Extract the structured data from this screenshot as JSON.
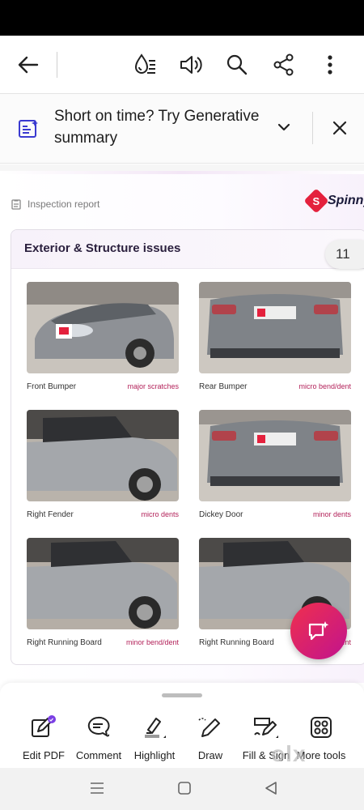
{
  "banner": {
    "text": "Short on time? Try Generative summary"
  },
  "report": {
    "label": "Inspection report",
    "brand": "Spinny",
    "brand_letter": "S",
    "section_title": "Exterior & Structure issues",
    "items": [
      {
        "part": "Front Bumper",
        "issue": "major scratches"
      },
      {
        "part": "Rear Bumper",
        "issue": "micro bend/dent"
      },
      {
        "part": "Right Fender",
        "issue": "micro dents"
      },
      {
        "part": "Dickey Door",
        "issue": "minor dents"
      },
      {
        "part": "Right Running Board",
        "issue": "minor bend/dent"
      },
      {
        "part": "Right Running Board",
        "issue": "ent"
      }
    ]
  },
  "page_indicator": "11",
  "tools": [
    {
      "label": "Edit PDF",
      "icon": "edit-pdf-icon"
    },
    {
      "label": "Comment",
      "icon": "comment-icon"
    },
    {
      "label": "Highlight",
      "icon": "highlight-icon"
    },
    {
      "label": "Draw",
      "icon": "draw-icon"
    },
    {
      "label": "Fill & Sign",
      "icon": "fill-sign-icon"
    },
    {
      "label": "More tools",
      "icon": "more-tools-icon"
    }
  ],
  "watermark": "olx",
  "colors": {
    "accent": "#e4213d",
    "issue_text": "#b3225a",
    "fab": "#e0245e"
  }
}
